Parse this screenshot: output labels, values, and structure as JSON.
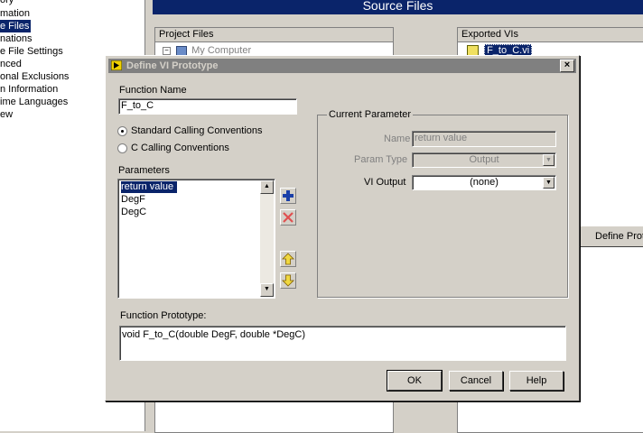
{
  "background": {
    "categories": [
      {
        "label": "ory",
        "selected": false
      },
      {
        "label": "mation",
        "selected": false
      },
      {
        "label": "e Files",
        "selected": true
      },
      {
        "label": "nations",
        "selected": false
      },
      {
        "label": "e File Settings",
        "selected": false
      },
      {
        "label": "nced",
        "selected": false
      },
      {
        "label": "onal Exclusions",
        "selected": false
      },
      {
        "label": "n Information",
        "selected": false
      },
      {
        "label": "ime Languages",
        "selected": false
      },
      {
        "label": "ew",
        "selected": false
      }
    ],
    "header_title": "Source Files",
    "project_files_label": "Project Files",
    "project_tree_item": "My Computer",
    "exported_vis_label": "Exported VIs",
    "exported_item": "F_to_C.vi",
    "define_prototype_button": "Define Proto"
  },
  "dialog": {
    "title": "Define VI Prototype",
    "close_glyph": "×",
    "function_name_label": "Function Name",
    "function_name_value": "F_to_C",
    "calling_conventions": [
      {
        "label": "Standard Calling Conventions",
        "checked": true
      },
      {
        "label": "C Calling Conventions",
        "checked": false
      }
    ],
    "parameters_label": "Parameters",
    "parameters": [
      {
        "label": "return value",
        "selected": true
      },
      {
        "label": "DegF",
        "selected": false
      },
      {
        "label": "DegC",
        "selected": false
      }
    ],
    "current_parameter": {
      "group_label": "Current Parameter",
      "name_label": "Name",
      "name_value": "return value",
      "param_type_label": "Param Type",
      "param_type_value": "Output",
      "vi_output_label": "VI Output",
      "vi_output_value": "(none)"
    },
    "function_prototype_label": "Function Prototype:",
    "function_prototype_value": "void F_to_C(double DegF, double *DegC)",
    "buttons": {
      "ok": "OK",
      "cancel": "Cancel",
      "help": "Help"
    }
  },
  "colors": {
    "selection": "#0a246a",
    "face": "#d4d0c8",
    "add_icon": "#1a3fa8",
    "delete_icon": "#e05050",
    "arrow_icon": "#c8a000"
  }
}
